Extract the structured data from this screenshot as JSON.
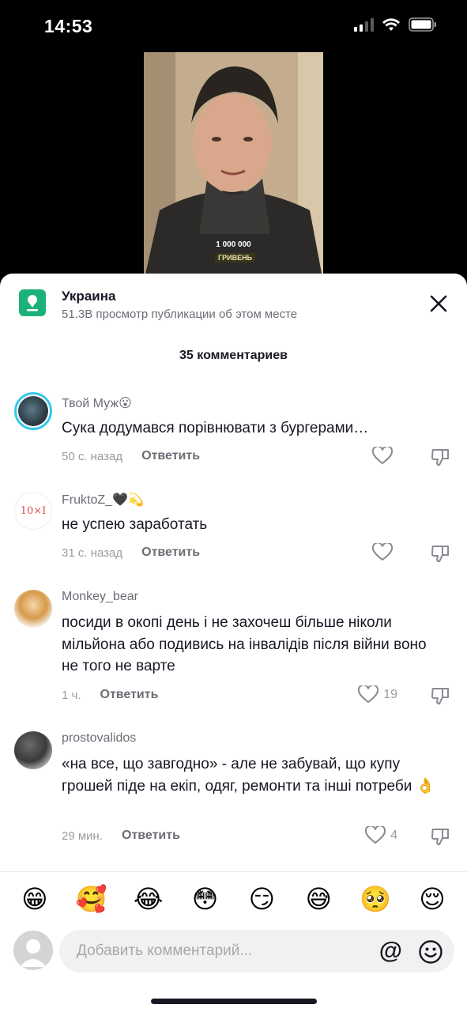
{
  "status": {
    "time": "14:53"
  },
  "video": {
    "caption_amount": "1 000 000",
    "caption_currency": "ГРИВЕНЬ"
  },
  "place": {
    "title": "Украина",
    "subtitle": "51.3B просмотр публикации об этом месте",
    "icon": "location-pin-icon",
    "accent_color": "#1db17a"
  },
  "comments_header": "35 комментариев",
  "comments": [
    {
      "user": "Твой Муж😮",
      "text": "Сука додумався порівнювати з бургерами…",
      "time": "50 с. назад",
      "reply": "Ответить",
      "likes": ""
    },
    {
      "user": "FruktoZ_🖤💫",
      "text": "не успею заработать",
      "time": "31 с. назад",
      "reply": "Ответить",
      "likes": ""
    },
    {
      "user": "Monkey_bear",
      "text": "посиди в окопі день і не захочеш більше ніколи мільйона або подивись на інвалідів після війни воно не того не варте",
      "time": "1 ч.",
      "reply": "Ответить",
      "likes": "19"
    },
    {
      "user": "prostovalidos",
      "text": "«на все, що завгодно» - але не забувай, що купу грошей піде на екіп, одяг, ремонти та інші потреби 👌",
      "time": "29 мин.",
      "reply": "Ответить",
      "likes": "4"
    }
  ],
  "emoji_bar": [
    "😁",
    "🥰",
    "😂",
    "😳",
    "😏",
    "😅",
    "🥺",
    "😌"
  ],
  "composer": {
    "placeholder": "Добавить комментарий...",
    "at_symbol": "@"
  }
}
